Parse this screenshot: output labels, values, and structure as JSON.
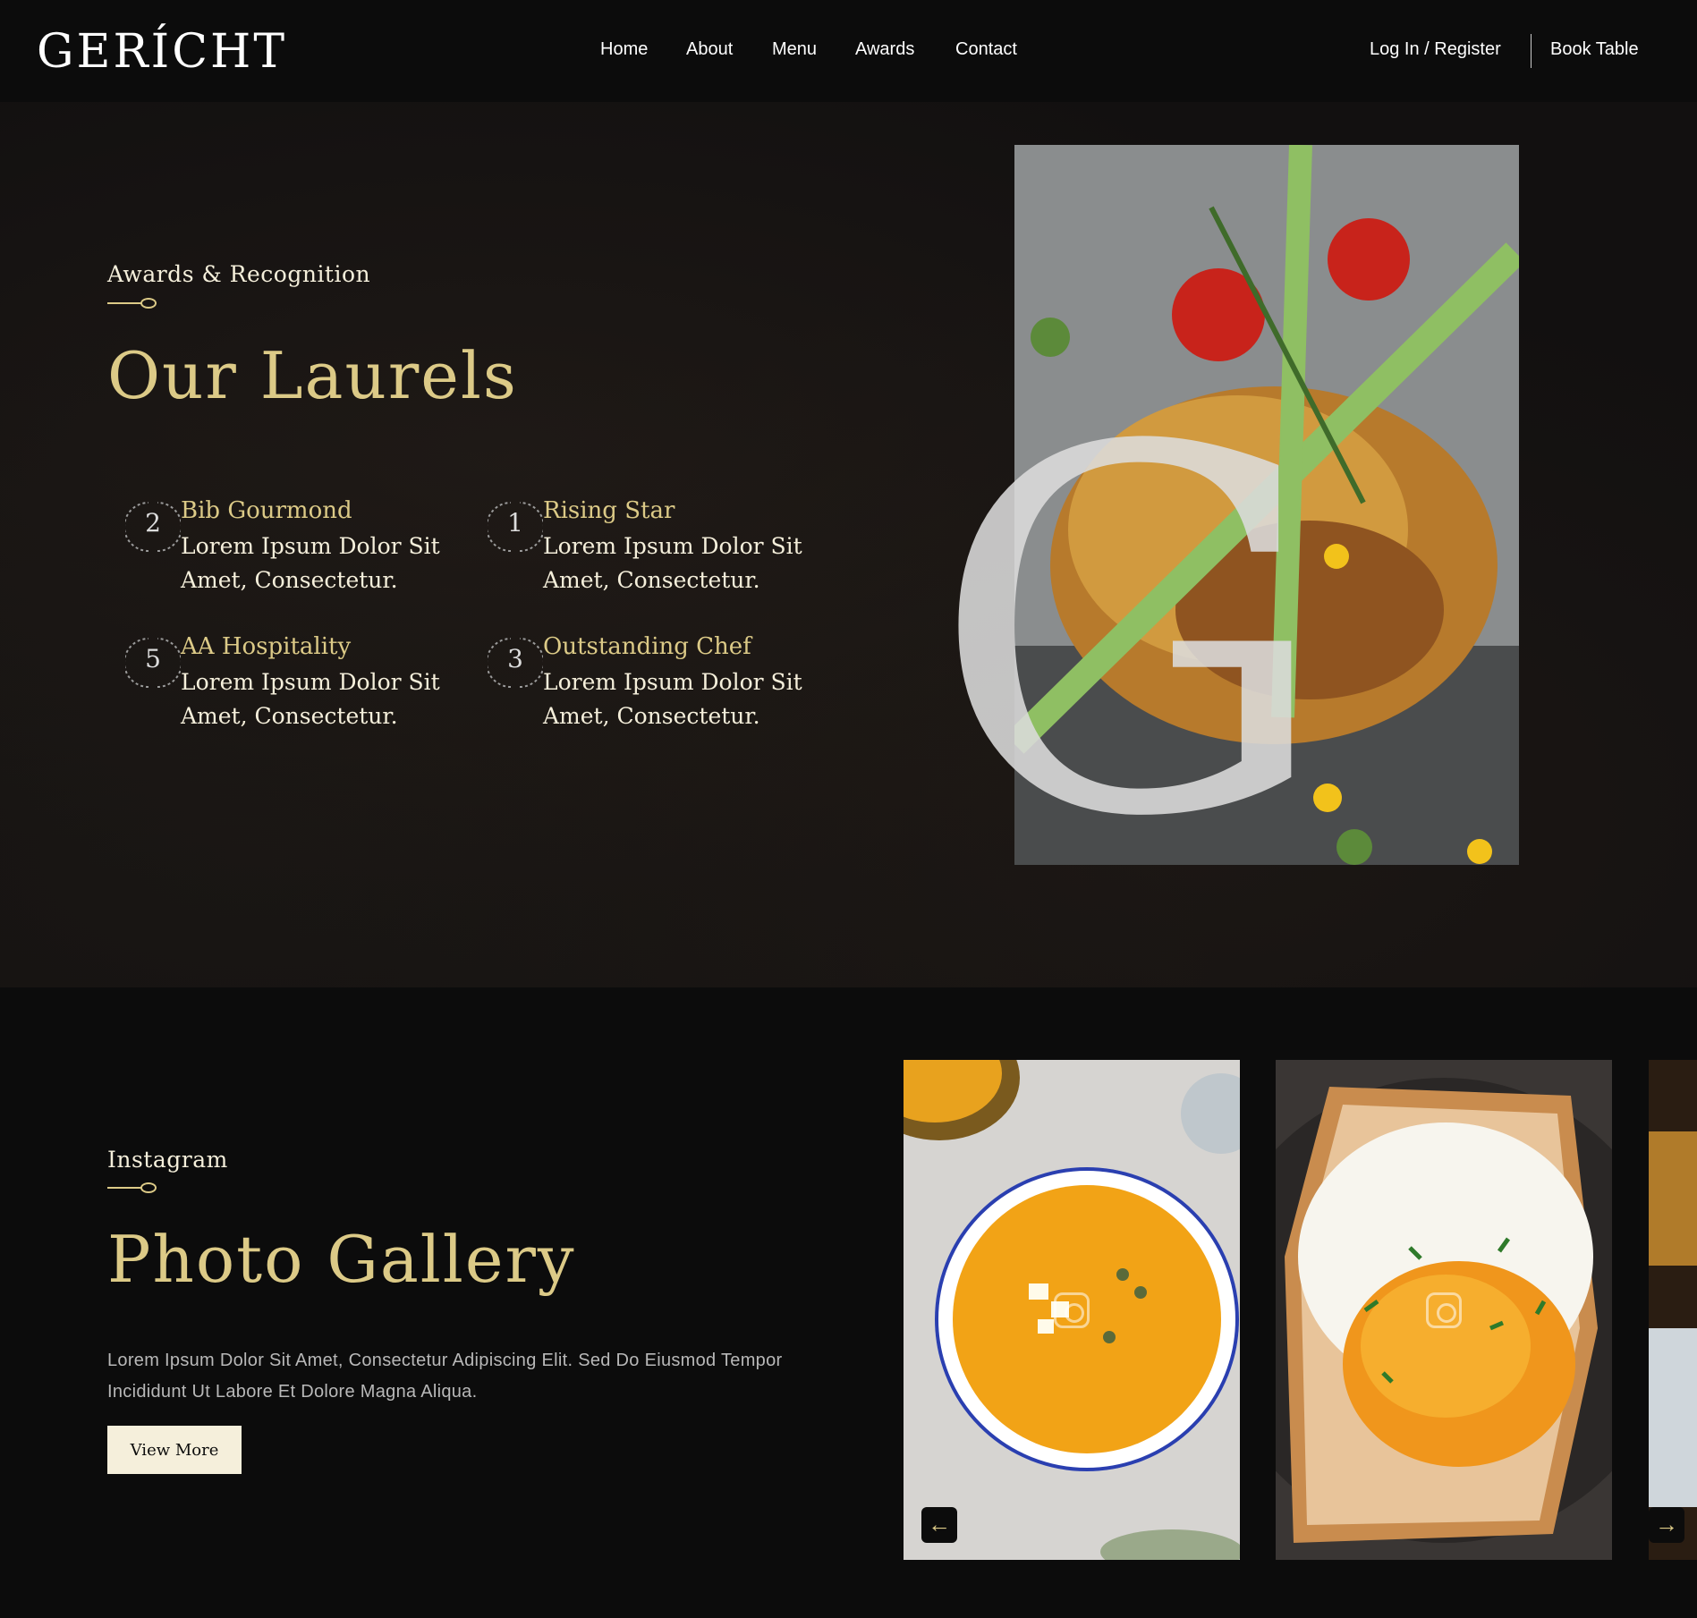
{
  "nav": {
    "logo": "GERÍCHT",
    "links": [
      "Home",
      "About",
      "Menu",
      "Awards",
      "Contact"
    ],
    "login": "Log In / Register",
    "book": "Book Table"
  },
  "laurels": {
    "subtitle": "Awards & Recognition",
    "title": "Our Laurels",
    "awards": [
      {
        "num": "2",
        "title": "Bib Gourmond",
        "desc": "Lorem Ipsum Dolor Sit Amet, Consectetur."
      },
      {
        "num": "1",
        "title": "Rising Star",
        "desc": "Lorem Ipsum Dolor Sit Amet, Consectetur."
      },
      {
        "num": "5",
        "title": "AA Hospitality",
        "desc": "Lorem Ipsum Dolor Sit Amet, Consectetur."
      },
      {
        "num": "3",
        "title": "Outstanding Chef",
        "desc": "Lorem Ipsum Dolor Sit Amet, Consectetur."
      }
    ],
    "decor_letter": "G"
  },
  "gallery": {
    "subtitle": "Instagram",
    "title": "Photo Gallery",
    "text": "Lorem Ipsum Dolor Sit Amet, Consectetur Adipiscing Elit. Sed Do Eiusmod Tempor Incididunt Ut Labore Et Dolore Magna Aliqua.",
    "button": "View More",
    "prev_arrow": "←",
    "next_arrow": "→"
  },
  "colors": {
    "gold": "#dcca87",
    "cream": "#f5efdb",
    "background": "#0c0c0c"
  },
  "icons": [
    "laurel-wreath-icon",
    "spoon-icon",
    "instagram-icon",
    "arrow-left-icon",
    "arrow-right-icon"
  ]
}
